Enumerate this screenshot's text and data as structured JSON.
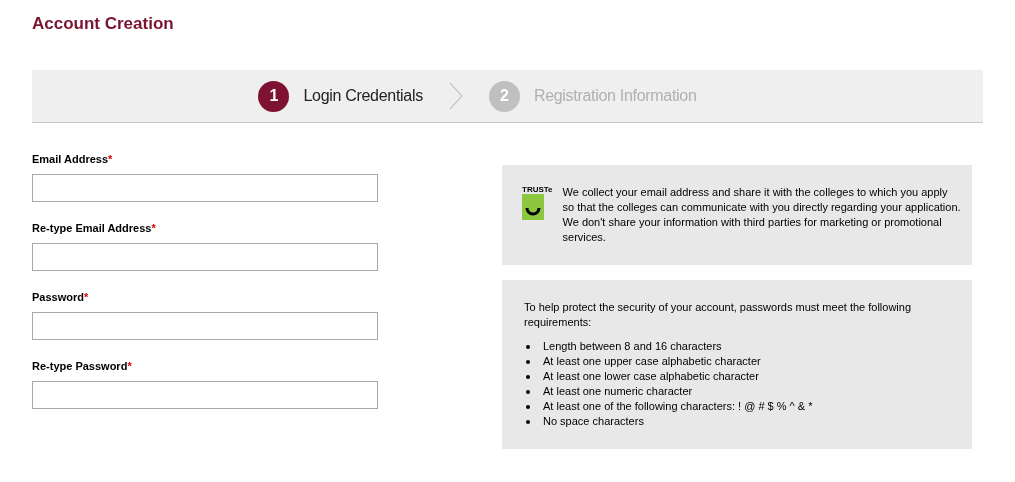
{
  "title": "Account Creation",
  "steps": [
    {
      "number": "1",
      "label": "Login Credentials",
      "selected": true
    },
    {
      "number": "2",
      "label": "Registration Information",
      "selected": false
    }
  ],
  "fields": [
    {
      "label": "Email Address",
      "required_mark": "*"
    },
    {
      "label": "Re-type Email Address",
      "required_mark": "*"
    },
    {
      "label": "Password",
      "required_mark": "*"
    },
    {
      "label": "Re-type Password",
      "required_mark": "*"
    }
  ],
  "privacy_panel": {
    "badge": "TRUSTe",
    "text": "We collect your email address and share it with the colleges to which you apply so that the colleges can communicate with you directly regarding your application. We don't share your information with third parties for marketing or promotional services."
  },
  "password_panel": {
    "intro": "To help protect the security of your account, passwords must meet the following requirements:",
    "requirements": [
      "Length between 8 and 16 characters",
      "At least one upper case alphabetic character",
      "At least one lower case alphabetic character",
      "At least one numeric character",
      "At least one of the following characters: ! @ # $ % ^ & *",
      "No space characters"
    ]
  }
}
